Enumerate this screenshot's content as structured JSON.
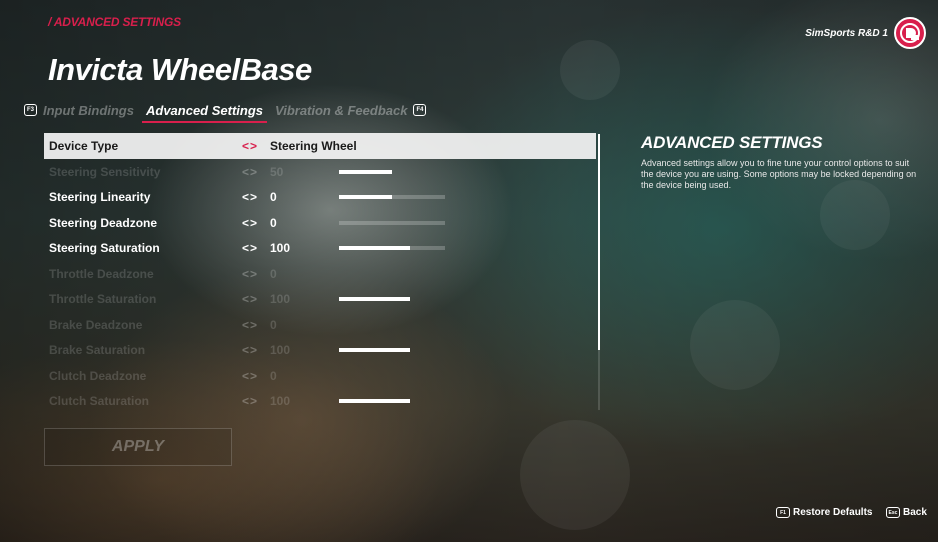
{
  "breadcrumb": "/ ADVANCED SETTINGS",
  "page_title": "Invicta WheelBase",
  "tabs": {
    "prev_key": "F3",
    "next_key": "F4",
    "items": [
      {
        "label": "Input Bindings",
        "active": false
      },
      {
        "label": "Advanced Settings",
        "active": true
      },
      {
        "label": "Vibration & Feedback",
        "active": false
      }
    ]
  },
  "profile": {
    "name": "SimSports R&D 1",
    "badge_icon": "season-pass-badge-icon"
  },
  "settings": [
    {
      "label": "Device Type",
      "value": "Steering Wheel",
      "state": "selected",
      "slider": null
    },
    {
      "label": "Steering Sensitivity",
      "value": "50",
      "state": "disabled",
      "slider": 0.5
    },
    {
      "label": "Steering Linearity",
      "value": "0",
      "state": "enabled",
      "slider": 0.5
    },
    {
      "label": "Steering Deadzone",
      "value": "0",
      "state": "enabled",
      "slider": 0
    },
    {
      "label": "Steering Saturation",
      "value": "100",
      "state": "enabled",
      "slider": 0.67
    },
    {
      "label": "Throttle Deadzone",
      "value": "0",
      "state": "disabled",
      "slider": null
    },
    {
      "label": "Throttle Saturation",
      "value": "100",
      "state": "disabled",
      "slider": 0.67
    },
    {
      "label": "Brake Deadzone",
      "value": "0",
      "state": "disabled",
      "slider": null
    },
    {
      "label": "Brake Saturation",
      "value": "100",
      "state": "disabled",
      "slider": 0.67
    },
    {
      "label": "Clutch Deadzone",
      "value": "0",
      "state": "disabled",
      "slider": null
    },
    {
      "label": "Clutch Saturation",
      "value": "100",
      "state": "disabled",
      "slider": 0.67
    }
  ],
  "arrows_glyph": "<>",
  "apply_label": "APPLY",
  "info_panel": {
    "title": "ADVANCED SETTINGS",
    "body": "Advanced settings allow you to fine tune your control options to suit the device you are using. Some options may be locked depending on the device being used."
  },
  "footer": {
    "restore": {
      "key": "F1",
      "label": "Restore Defaults"
    },
    "back": {
      "key": "Esc",
      "label": "Back"
    }
  },
  "colors": {
    "accent": "#d81f4c",
    "selected_row": "#f5f5f5"
  }
}
